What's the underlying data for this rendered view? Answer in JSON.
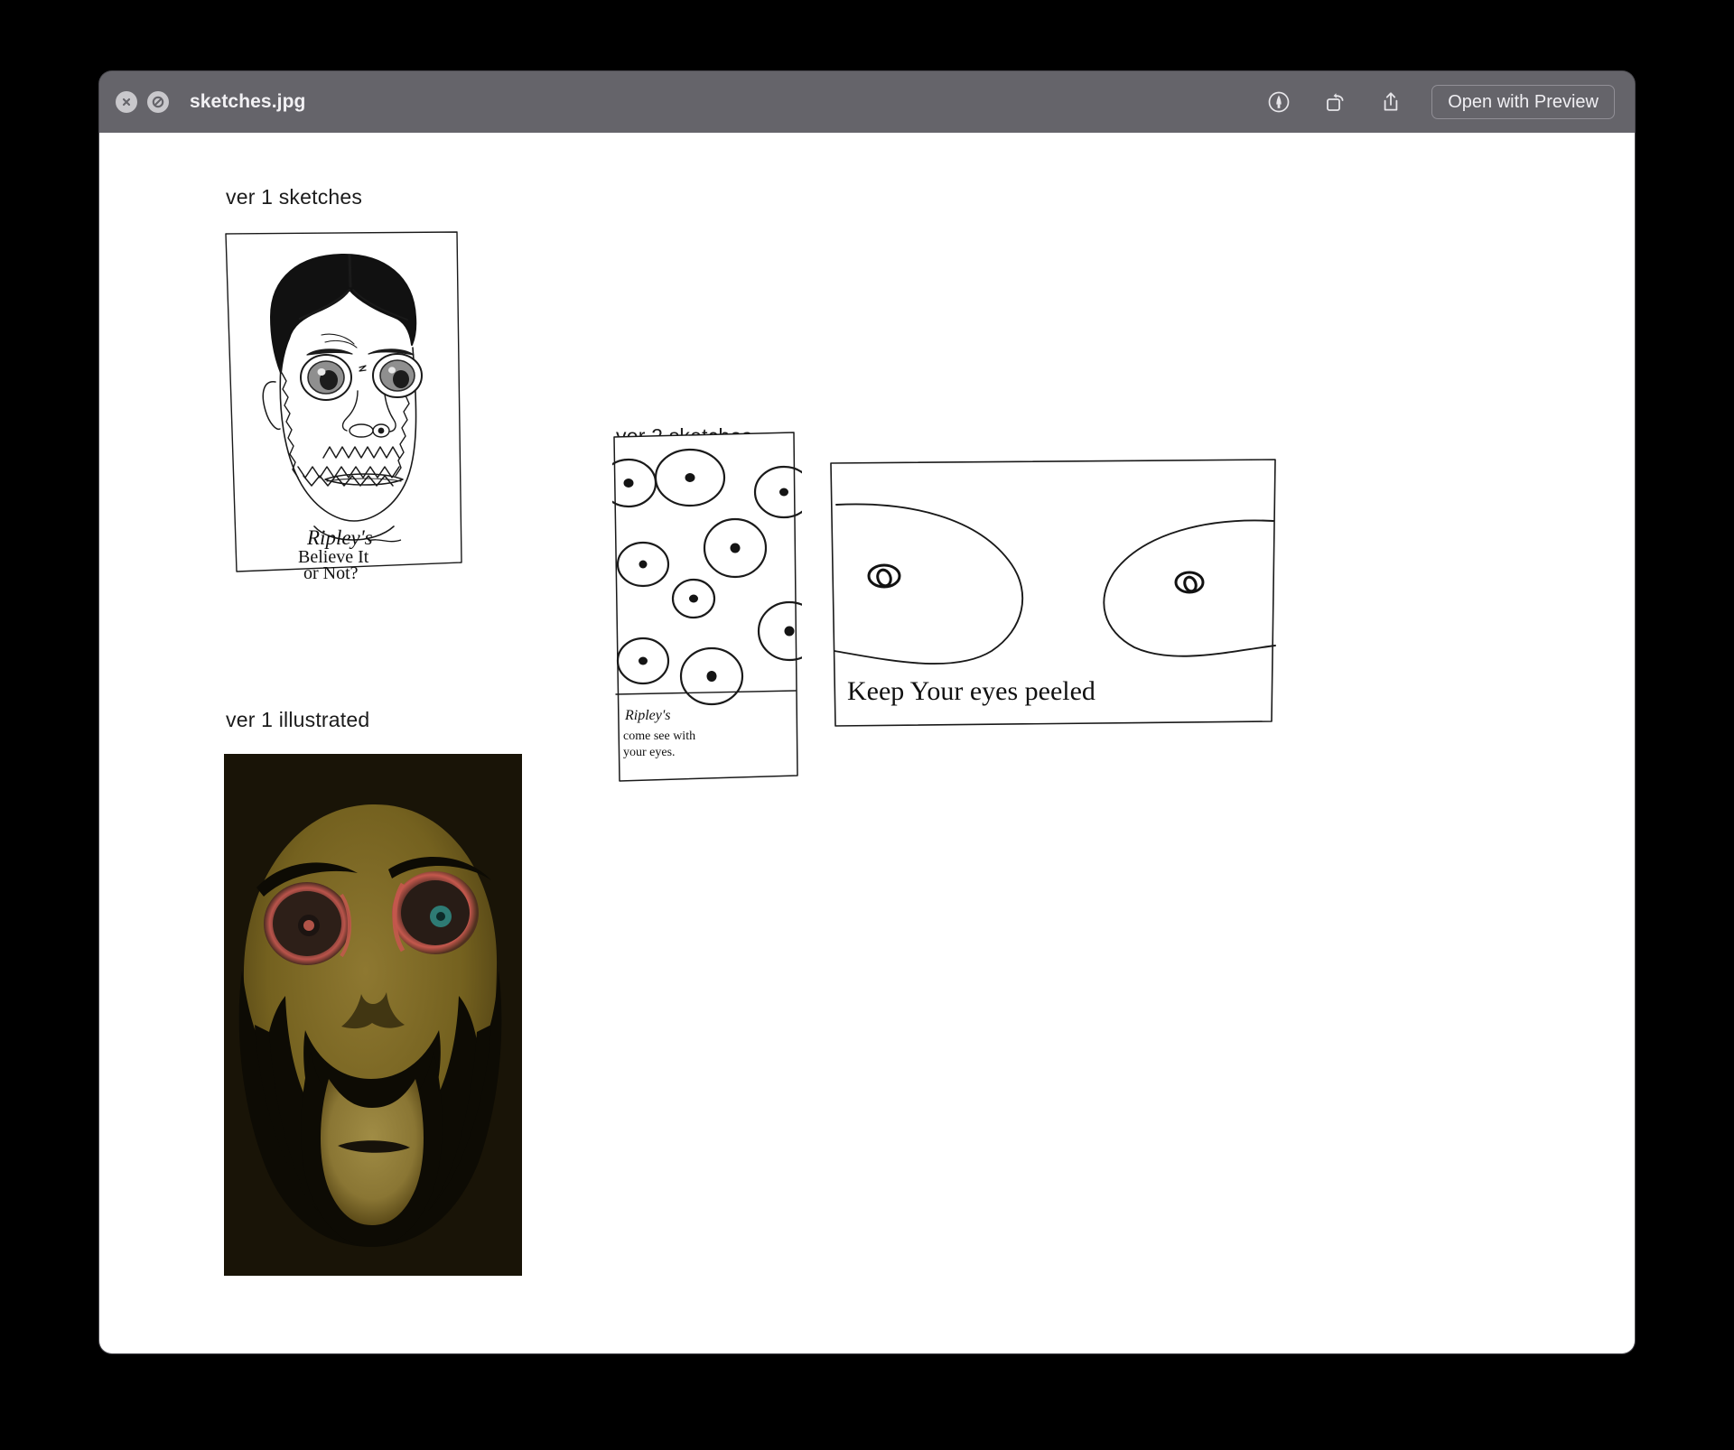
{
  "window": {
    "title": "sketches.jpg",
    "controls": [
      {
        "name": "close-button",
        "icon": "close-x-icon"
      },
      {
        "name": "no-entry-button",
        "icon": "slash-circle-icon"
      }
    ],
    "toolbar": {
      "markup_icon": "markup-pen-icon",
      "rotate_icon": "rotate-left-icon",
      "share_icon": "share-upload-icon",
      "open_with_preview_label": "Open with Preview"
    }
  },
  "content": {
    "sections": [
      {
        "key": "ver1_sketches",
        "label": "ver 1 sketches"
      },
      {
        "key": "ver1_illustrated",
        "label": "ver 1 illustrated"
      },
      {
        "key": "ver2_sketches",
        "label": "ver 2 sketches"
      }
    ],
    "artworks": {
      "ver1_sketch": {
        "name": "hand-drawn portrait with large eyes, beard and hair",
        "handwriting_lines": [
          "Ripley's",
          "Believe It",
          "or Not?"
        ]
      },
      "ver1_illustrated": {
        "name": "digitally painted dark portrait with glowing red-rimmed eyes",
        "colors": {
          "background": "#191407",
          "skin": "#7a6626",
          "skin_light": "#9c8638",
          "skin_shadow": "#574717",
          "hair": "#0d0b04",
          "eye_ring": "#c4544b",
          "eye_inner": "#2a1d16",
          "iris_highlight": "#2e7b74"
        }
      },
      "ver2_eyes_grid": {
        "name": "poster of many scattered hand-drawn eyes",
        "eye_count": 10,
        "handwriting_lines": [
          "Ripley's",
          "come see with",
          "your eyes."
        ]
      },
      "ver2_big_eyes": {
        "name": "poster of two very large cropped eyes",
        "handwriting_lines": [
          "Keep Your eyes peeled"
        ]
      }
    }
  }
}
